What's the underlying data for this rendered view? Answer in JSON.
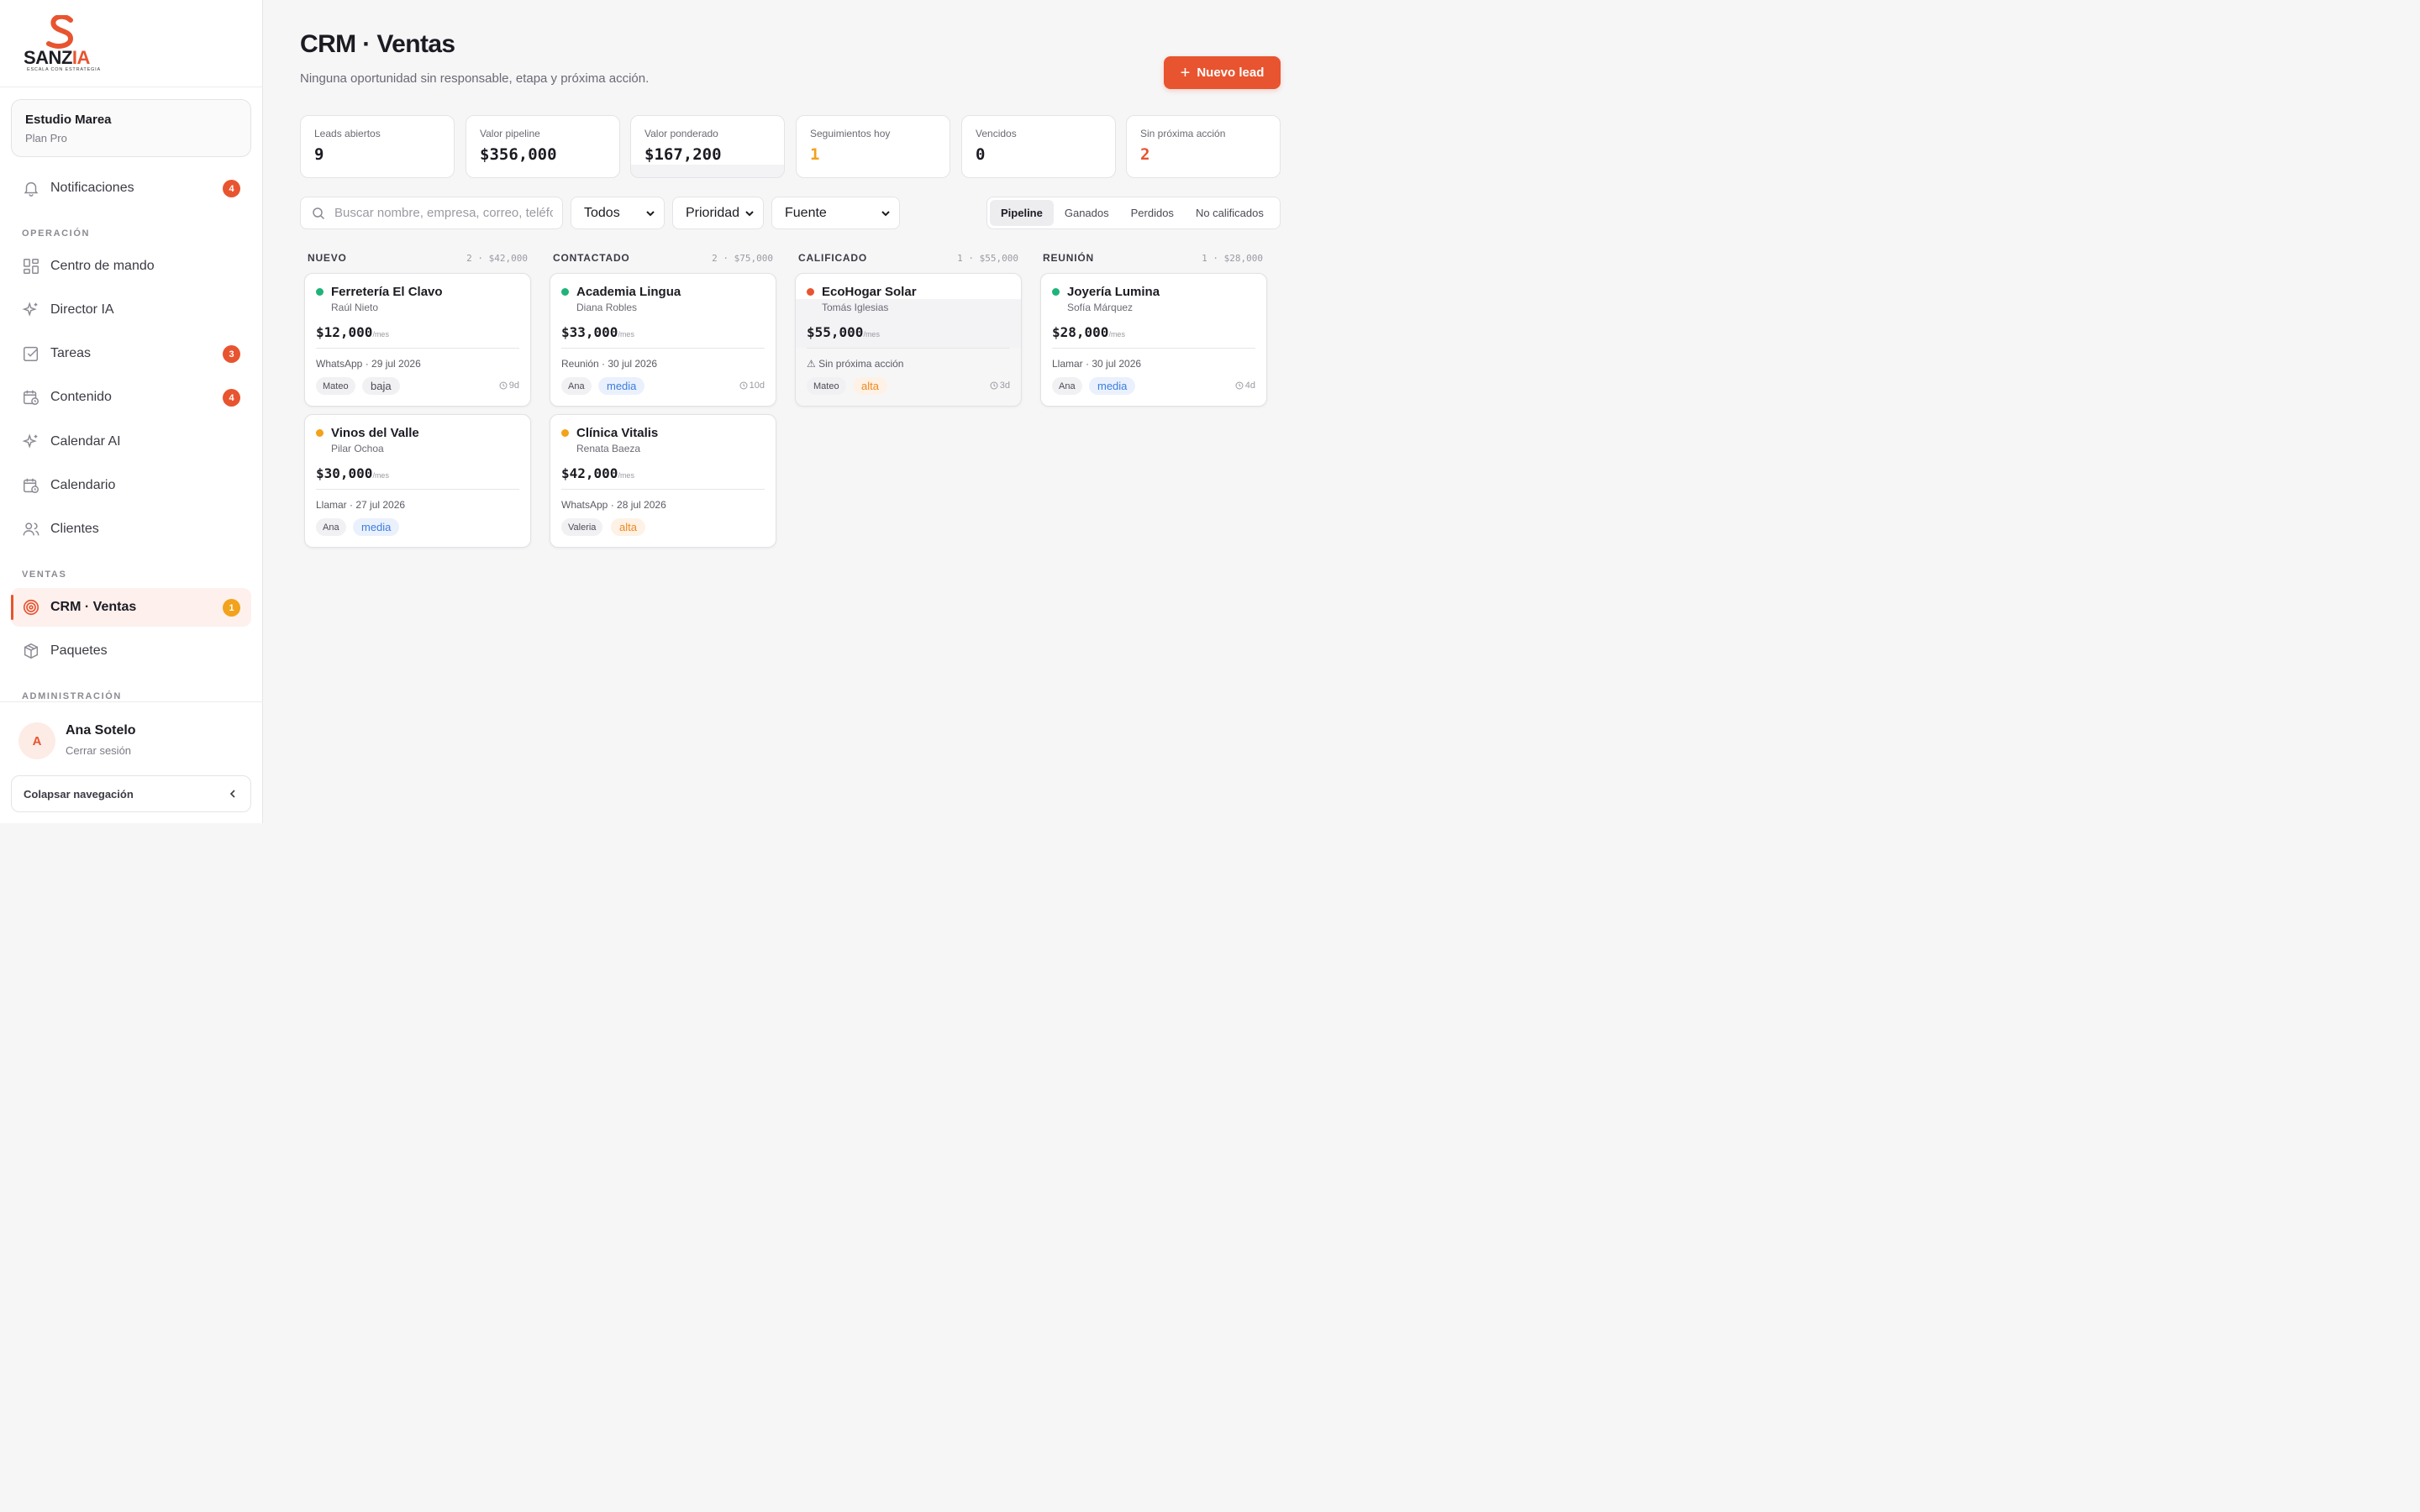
{
  "brand": {
    "name_main": "SANZ",
    "name_accent": "IA",
    "tagline": "ESCALA CON ESTRATEGIA",
    "accent_color": "#e8542f"
  },
  "workspace": {
    "name": "Estudio Marea",
    "plan": "Plan Pro"
  },
  "nav": {
    "notifications": {
      "label": "Notificaciones",
      "icon": "bell-icon",
      "badge": "4"
    },
    "section_operacion": "OPERACIÓN",
    "operacion": [
      {
        "label": "Centro de mando",
        "icon": "dashboard-grid-icon",
        "badge": ""
      },
      {
        "label": "Director IA",
        "icon": "sparkles-icon",
        "badge": ""
      },
      {
        "label": "Tareas",
        "icon": "checkbox-icon",
        "badge": "3"
      },
      {
        "label": "Contenido",
        "icon": "calendar-clock-icon",
        "badge": "4"
      },
      {
        "label": "Calendar AI",
        "icon": "sparkles-icon",
        "badge": ""
      },
      {
        "label": "Calendario",
        "icon": "calendar-clock-icon",
        "badge": ""
      },
      {
        "label": "Clientes",
        "icon": "users-icon",
        "badge": ""
      }
    ],
    "section_ventas": "VENTAS",
    "ventas": [
      {
        "label": "CRM · Ventas",
        "icon": "target-icon",
        "badge": "1",
        "active": true
      },
      {
        "label": "Paquetes",
        "icon": "package-icon",
        "badge": ""
      }
    ],
    "section_admin": "ADMINISTRACIÓN"
  },
  "user": {
    "initial": "A",
    "name": "Ana Sotelo",
    "logout": "Cerrar sesión"
  },
  "collapse_label": "Colapsar navegación",
  "page": {
    "title": "CRM · Ventas",
    "subtitle": "Ninguna oportunidad sin responsable, etapa y próxima acción.",
    "new_lead": "Nuevo lead"
  },
  "kpis": [
    {
      "label": "Leads abiertos",
      "value": "9"
    },
    {
      "label": "Valor pipeline",
      "value": "$356,000"
    },
    {
      "label": "Valor ponderado",
      "value": "$167,200"
    },
    {
      "label": "Seguimientos hoy",
      "value": "1"
    },
    {
      "label": "Vencidos",
      "value": "0"
    },
    {
      "label": "Sin próxima acción",
      "value": "2"
    }
  ],
  "filters": {
    "search_placeholder": "Buscar nombre, empresa, correo, teléfono",
    "owner": "Todos",
    "priority": "Prioridad",
    "source": "Fuente"
  },
  "views": [
    "Pipeline",
    "Ganados",
    "Perdidos",
    "No calificados"
  ],
  "columns": [
    {
      "name": "NUEVO",
      "summary": "2 · $42,000",
      "cards": [
        {
          "company": "Ferretería El Clavo",
          "contact": "Raúl Nieto",
          "amount": "$12,000",
          "unit": "/mes",
          "next": "WhatsApp · 29 jul 2026",
          "owner": "Mateo",
          "priority": "baja",
          "age": "9d",
          "status_color": "#1fb37a"
        },
        {
          "company": "Vinos del Valle",
          "contact": "Pilar Ochoa",
          "amount": "$30,000",
          "unit": "/mes",
          "next": "Llamar · 27 jul 2026",
          "owner": "Ana",
          "priority": "media",
          "age": "",
          "status_color": "#f2a21b"
        }
      ]
    },
    {
      "name": "CONTACTADO",
      "summary": "2 · $75,000",
      "cards": [
        {
          "company": "Academia Lingua",
          "contact": "Diana Robles",
          "amount": "$33,000",
          "unit": "/mes",
          "next": "Reunión · 30 jul 2026",
          "owner": "Ana",
          "priority": "media",
          "age": "10d",
          "status_color": "#1fb37a"
        },
        {
          "company": "Clínica Vitalis",
          "contact": "Renata Baeza",
          "amount": "$42,000",
          "unit": "/mes",
          "next": "WhatsApp · 28 jul 2026",
          "owner": "Valeria",
          "priority": "alta",
          "age": "",
          "status_color": "#f2a21b"
        }
      ]
    },
    {
      "name": "CALIFICADO",
      "summary": "1 · $55,000",
      "cards": [
        {
          "company": "EcoHogar Solar",
          "contact": "Tomás Iglesias",
          "amount": "$55,000",
          "unit": "/mes",
          "next": "⚠ Sin próxima acción",
          "owner": "Mateo",
          "priority": "alta",
          "age": "3d",
          "status_color": "#e8542f"
        }
      ]
    },
    {
      "name": "REUNIÓN",
      "summary": "1 · $28,000",
      "cards": [
        {
          "company": "Joyería Lumina",
          "contact": "Sofía Márquez",
          "amount": "$28,000",
          "unit": "/mes",
          "next": "Llamar · 30 jul 2026",
          "owner": "Ana",
          "priority": "media",
          "age": "4d",
          "status_color": "#1fb37a"
        }
      ]
    }
  ]
}
